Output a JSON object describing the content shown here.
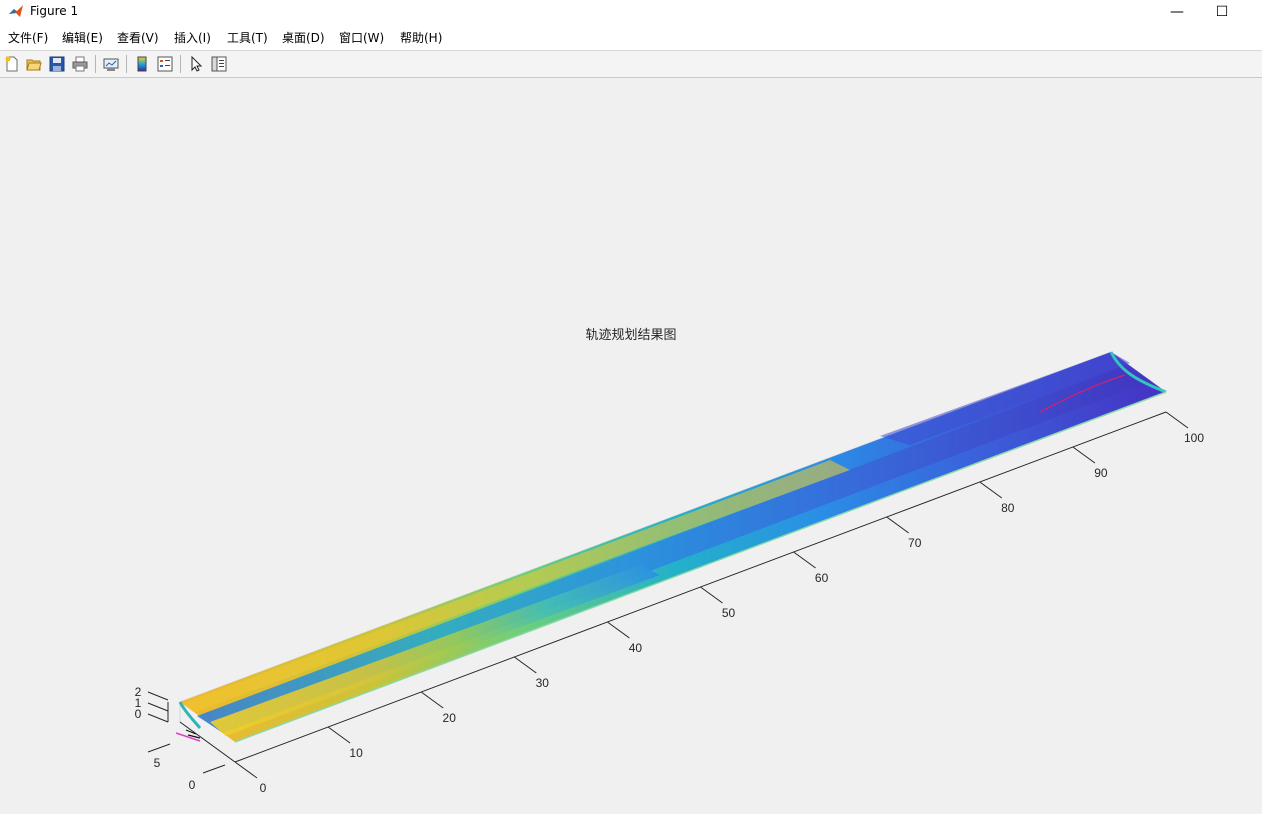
{
  "window": {
    "title": "Figure 1",
    "minimize_glyph": "—",
    "maximize_glyph": "☐"
  },
  "menu": [
    {
      "label": "文件(F)"
    },
    {
      "label": "编辑(E)"
    },
    {
      "label": "查看(V)"
    },
    {
      "label": "插入(I)"
    },
    {
      "label": "工具(T)"
    },
    {
      "label": "桌面(D)"
    },
    {
      "label": "窗口(W)"
    },
    {
      "label": "帮助(H)"
    }
  ],
  "toolbar": [
    {
      "icon": "new-figure-icon"
    },
    {
      "icon": "open-file-icon"
    },
    {
      "icon": "save-icon"
    },
    {
      "icon": "print-icon"
    },
    {
      "icon": "link-plot-icon"
    },
    {
      "icon": "insert-colorbar-icon"
    },
    {
      "icon": "insert-legend-icon"
    },
    {
      "icon": "edit-plot-arrow-icon"
    },
    {
      "icon": "property-inspector-icon"
    }
  ],
  "chart_data": {
    "type": "surface",
    "title": "轨迹规划结果图",
    "x_ticks": [
      "0",
      "10",
      "20",
      "30",
      "40",
      "50",
      "60",
      "70",
      "80",
      "90",
      "100"
    ],
    "xlim": [
      0,
      100
    ],
    "y_ticks": [
      "0",
      "5"
    ],
    "z_ticks": [
      "0",
      "1",
      "2"
    ],
    "zlim": [
      0,
      2
    ],
    "colormap": "parula",
    "colors": {
      "low": "#3e26a8",
      "mid": "#1ea8d8",
      "high": "#f9d020",
      "trajectory": "#e0187a"
    }
  }
}
